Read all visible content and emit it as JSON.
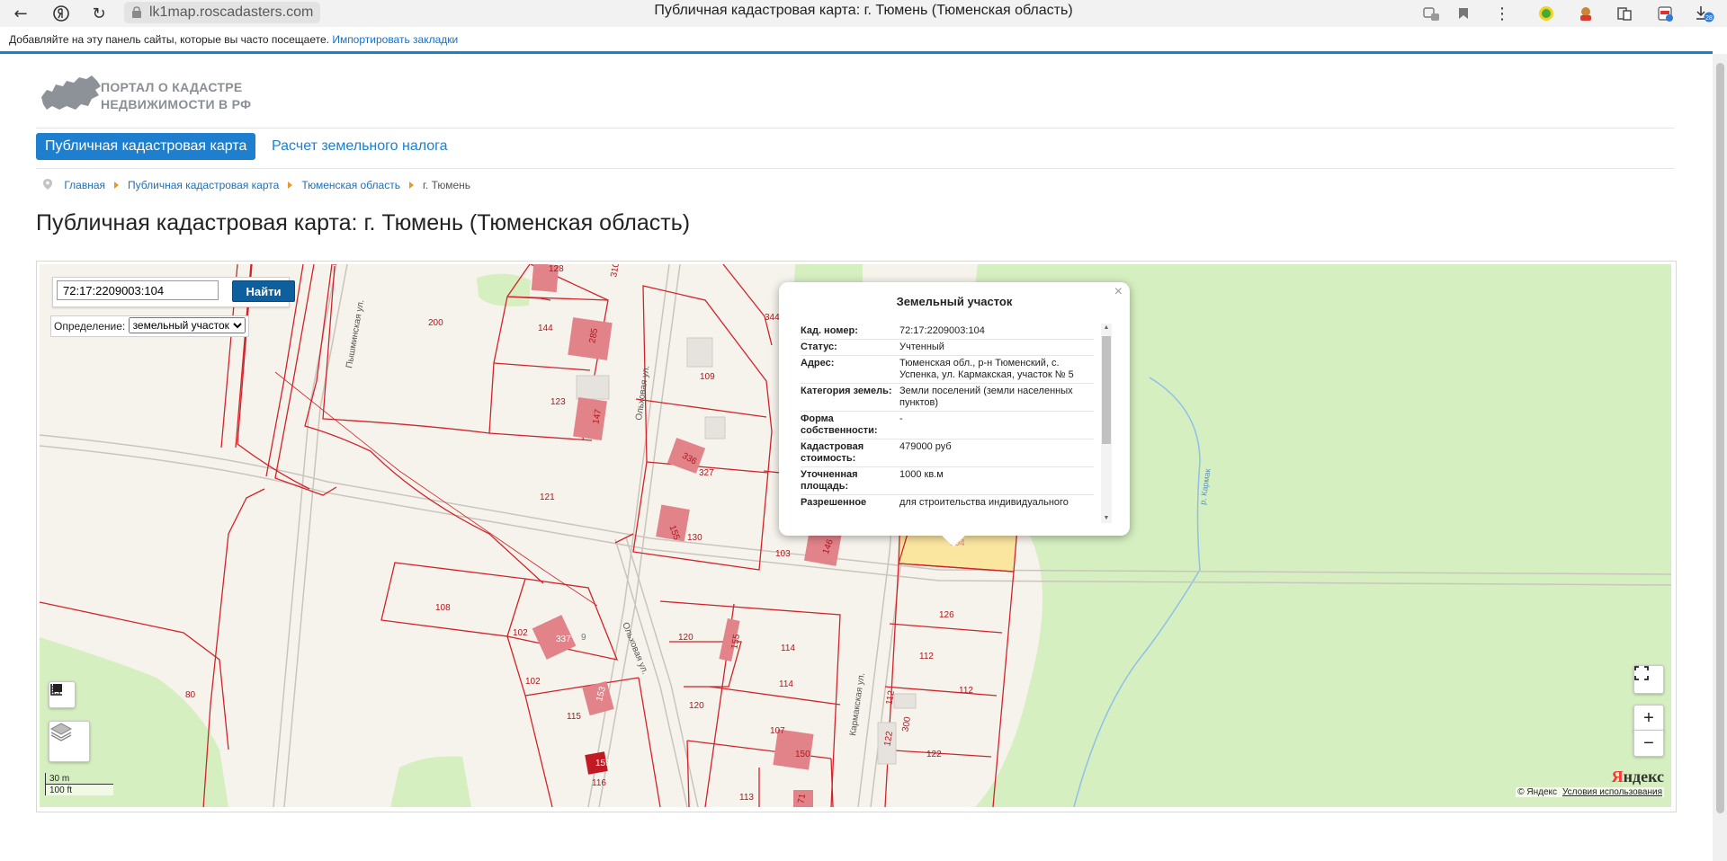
{
  "browser": {
    "url": "lk1map.roscadasters.com",
    "tab_title": "Публичная кадастровая карта: г. Тюмень (Тюменская область)",
    "bookmarks_text": "Добавляйте на эту панель сайты, которые вы часто посещаете.",
    "bookmarks_link": "Импортировать закладки",
    "downloads_badge": "28"
  },
  "site": {
    "logo_line1": "ПОРТАЛ О КАДАСТРЕ",
    "logo_line2": "НЕДВИЖИМОСТИ В РФ",
    "nav": [
      "Публичная кадастровая карта",
      "Расчет земельного налога"
    ],
    "breadcrumbs": [
      "Главная",
      "Публичная кадастровая карта",
      "Тюменская область",
      "г. Тюмень"
    ],
    "page_title": "Публичная кадастровая карта: г. Тюмень (Тюменская область)"
  },
  "map": {
    "search_value": "72:17:2209003:104",
    "search_button": "Найти",
    "definition_label": "Определение:",
    "definition_value": "земельный участок",
    "streets": [
      "Пышминская ул.",
      "Ольховая ул.",
      "Ольховая ул.",
      "Кармакская ул.",
      "р. Кармак"
    ],
    "parcel_labels": [
      "128",
      "310",
      "200",
      "144",
      "285",
      "344",
      "109",
      "123",
      "147",
      "121",
      "336",
      "327",
      "155",
      "130",
      "103",
      "146",
      "104",
      "108",
      "102",
      "337",
      "9",
      "120",
      "155",
      "114",
      "126",
      "112",
      "112",
      "80",
      "102",
      "153",
      "115",
      "114",
      "120",
      "112",
      "300",
      "107",
      "150",
      "122",
      "122",
      "159",
      "116",
      "113",
      "71"
    ],
    "scale_m": "30 m",
    "scale_ft": "100 ft",
    "attribution": "© Яндекс",
    "terms": "Условия использования",
    "provider_logo": [
      "Я",
      "ндекс"
    ],
    "zoom_in": "+",
    "zoom_out": "−",
    "colors": {
      "parcel_line": "#d2232a",
      "building": "#e2838a",
      "green": "#d6efc0",
      "selected": "#fbe6a0"
    }
  },
  "popup": {
    "title": "Земельный участок",
    "close": "×",
    "rows": [
      {
        "k": "Кад. номер:",
        "v": "72:17:2209003:104"
      },
      {
        "k": "Статус:",
        "v": "Учтенный"
      },
      {
        "k": "Адрес:",
        "v": "Тюменская обл., р-н Тюменский, с. Успенка, ул. Кармакская, участок № 5"
      },
      {
        "k": "Категория земель:",
        "v": "Земли поселений (земли населенных пунктов)"
      },
      {
        "k": "Форма собственности:",
        "v": "-"
      },
      {
        "k": "Кадастровая стоимость:",
        "v": "479000 руб"
      },
      {
        "k": "Уточненная площадь:",
        "v": "1000 кв.м"
      },
      {
        "k": "Разрешенное",
        "v": "для строительства индивидуального"
      }
    ]
  }
}
